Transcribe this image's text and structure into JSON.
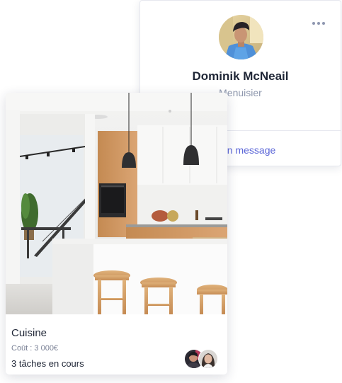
{
  "profile": {
    "name": "Dominik McNeail",
    "role": "Menuisier",
    "message_link": "ver un message",
    "more_icon": "more-dots-icon"
  },
  "project": {
    "title": "Cuisine",
    "cost": "Coût : 3 000€",
    "tasks": "3 tâches en cours",
    "image": "kitchen-photo",
    "members": [
      "member-avatar-1",
      "member-avatar-2"
    ]
  },
  "colors": {
    "accent": "#5b66d8",
    "name": "#1f2636",
    "role": "#8e97ad"
  }
}
